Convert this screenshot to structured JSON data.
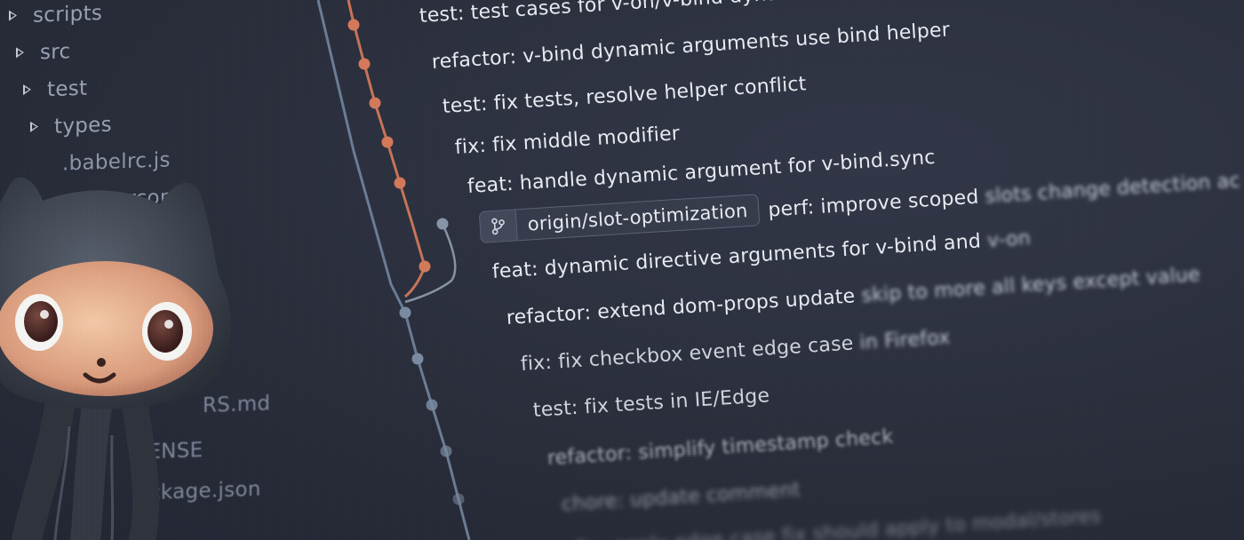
{
  "file_tree": {
    "items": [
      {
        "label": "scripts",
        "kind": "folder"
      },
      {
        "label": "src",
        "kind": "folder"
      },
      {
        "label": "test",
        "kind": "folder"
      },
      {
        "label": "types",
        "kind": "folder"
      },
      {
        "label": ".babelrc.js",
        "kind": "file"
      },
      {
        "label": ".editorconfig",
        "kind": "file"
      },
      {
        "label": "RS.md",
        "kind": "file"
      },
      {
        "label": "CENSE",
        "kind": "file"
      },
      {
        "label": "ckage.json",
        "kind": "file"
      }
    ]
  },
  "commit_graph": {
    "colors": {
      "main_line": "#6b7f96",
      "branch_line": "#c8765a",
      "main_node": "#7c8da3",
      "branch_node": "#d47c5c",
      "side_node": "#8a96a8"
    },
    "commits": [
      {
        "message": "test: test cases for v-on/v-bind dynamic arguments",
        "blur_from": ""
      },
      {
        "message": "refactor: v-bind dynamic arguments use bind helper",
        "blur_from": ""
      },
      {
        "message": "test: fix tests, resolve helper conflict",
        "blur_from": ""
      },
      {
        "message": "fix: fix middle modifier",
        "blur_from": ""
      },
      {
        "message": "feat: handle dynamic argument for v-bind.sync",
        "blur_from": ""
      },
      {
        "message": "perf: improve scoped slots change detection ac",
        "sharp": "perf: improve scoped ",
        "blurred": "slots change detection ac",
        "branch": "origin/slot-optimization"
      },
      {
        "message": "feat: dynamic directive arguments for v-bind and v-on",
        "sharp": "feat: dynamic directive arguments for v-bind and ",
        "blurred": "v-on"
      },
      {
        "message": "refactor: extend dom-props update skip to more all keys except value",
        "sharp": "refactor: extend dom-props update ",
        "blurred": "skip to more all keys except value"
      },
      {
        "message": "fix: fix checkbox event edge case in Firefox",
        "sharp": "fix: fix checkbox event edge case ",
        "blurred": "in Firefox"
      },
      {
        "message": "test: fix tests in IE/Edge",
        "sharp": "test: fix tests in IE/Edge",
        "blurred": ""
      },
      {
        "message": "refactor: simplify timestamp check"
      },
      {
        "message": "chore: update comment"
      },
      {
        "message": "fix: apply edge case fix should apply to modal/stores"
      }
    ]
  },
  "mascot": {
    "name": "octocat",
    "icon": "octocat-icon"
  }
}
